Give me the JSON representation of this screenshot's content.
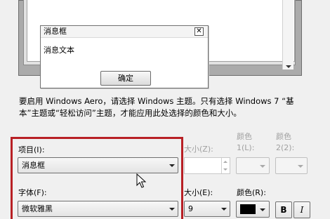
{
  "preview": {
    "msgbox_title": "消息框",
    "msgbox_close": "✕",
    "msgbox_text": "消息文本",
    "ok_label": "确定"
  },
  "info_text": "要启用 Windows Aero，请选择 Windows 主题。只有选择 Windows 7 “基本”主题或“轻松访问”主题，才能应用此处选择的颜色和大小。",
  "item": {
    "label": "项目(I):",
    "value": "消息框"
  },
  "size1": {
    "label": "大小(Z):"
  },
  "color1": {
    "label_line1": "颜色",
    "label_line2": "1(L):"
  },
  "color2": {
    "label_line1": "颜色",
    "label_line2": "2(2):"
  },
  "font": {
    "label": "字体(F):",
    "value": "微软雅黑"
  },
  "font_size": {
    "label": "大小(E):",
    "value": "9"
  },
  "font_color": {
    "label": "颜色(R):",
    "value": "#000000"
  },
  "bold_label": "B",
  "italic_label": "I",
  "colors": {
    "highlight": "#b82025"
  }
}
